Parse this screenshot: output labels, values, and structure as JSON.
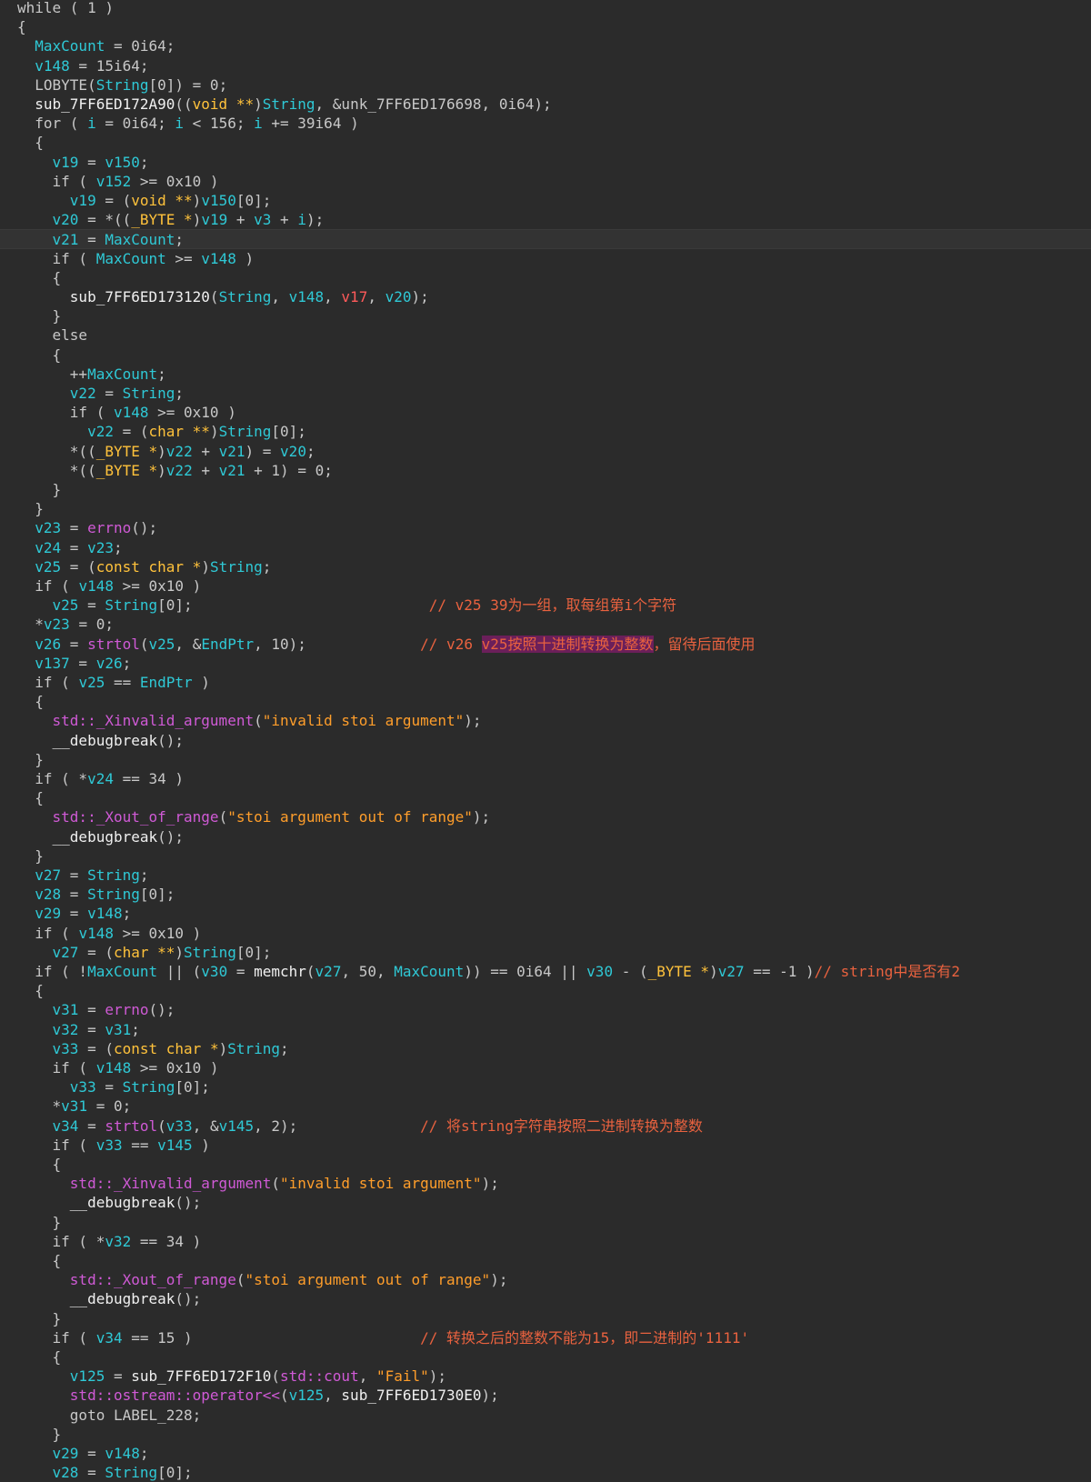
{
  "colors": {
    "background": "#2b2b2b",
    "plain": "#c8c8c8",
    "variable": "#2fc9d6",
    "function": "#f0f0f0",
    "keyword_type": "#ffc23b",
    "library": "#d05ad6",
    "string": "#ff9e2b",
    "comment": "#e9623f",
    "red_var": "#ff5a5a",
    "highlight": "#6b1f5a"
  },
  "current_line_index": 12,
  "lines": [
    [
      [
        "o",
        "while ( 1 )"
      ]
    ],
    [
      [
        "o",
        "{"
      ]
    ],
    [
      [
        "o",
        "  "
      ],
      [
        "v",
        "MaxCount"
      ],
      [
        "o",
        " = 0i64;"
      ]
    ],
    [
      [
        "o",
        "  "
      ],
      [
        "v",
        "v148"
      ],
      [
        "o",
        " = 15i64;"
      ]
    ],
    [
      [
        "o",
        "  LOBYTE("
      ],
      [
        "v",
        "String"
      ],
      [
        "o",
        "[0]) = 0;"
      ]
    ],
    [
      [
        "o",
        "  "
      ],
      [
        "f",
        "sub_7FF6ED172A90"
      ],
      [
        "o",
        "(("
      ],
      [
        "k",
        "void"
      ],
      [
        "o",
        " "
      ],
      [
        "k",
        "**"
      ],
      [
        "o",
        ")"
      ],
      [
        "v",
        "String"
      ],
      [
        "o",
        ", &unk_7FF6ED176698, 0i64);"
      ]
    ],
    [
      [
        "o",
        "  for ( "
      ],
      [
        "v",
        "i"
      ],
      [
        "o",
        " = 0i64; "
      ],
      [
        "v",
        "i"
      ],
      [
        "o",
        " < 156; "
      ],
      [
        "v",
        "i"
      ],
      [
        "o",
        " += 39i64 )"
      ]
    ],
    [
      [
        "o",
        "  {"
      ]
    ],
    [
      [
        "o",
        "    "
      ],
      [
        "v",
        "v19"
      ],
      [
        "o",
        " = "
      ],
      [
        "v",
        "v150"
      ],
      [
        "o",
        ";"
      ]
    ],
    [
      [
        "o",
        "    if ( "
      ],
      [
        "v",
        "v152"
      ],
      [
        "o",
        " >= 0x10 )"
      ]
    ],
    [
      [
        "o",
        "      "
      ],
      [
        "v",
        "v19"
      ],
      [
        "o",
        " = ("
      ],
      [
        "k",
        "void"
      ],
      [
        "o",
        " "
      ],
      [
        "k",
        "**"
      ],
      [
        "o",
        ")"
      ],
      [
        "v",
        "v150"
      ],
      [
        "o",
        "[0];"
      ]
    ],
    [
      [
        "o",
        "    "
      ],
      [
        "v",
        "v20"
      ],
      [
        "o",
        " = *(("
      ],
      [
        "k",
        "_BYTE"
      ],
      [
        "o",
        " "
      ],
      [
        "k",
        "*"
      ],
      [
        "o",
        ")"
      ],
      [
        "v",
        "v19"
      ],
      [
        "o",
        " + "
      ],
      [
        "v",
        "v3"
      ],
      [
        "o",
        " + "
      ],
      [
        "v",
        "i"
      ],
      [
        "o",
        ");"
      ]
    ],
    [
      [
        "o",
        "    "
      ],
      [
        "v",
        "v21"
      ],
      [
        "o",
        " = "
      ],
      [
        "v",
        "MaxCount"
      ],
      [
        "o",
        ";"
      ]
    ],
    [
      [
        "o",
        "    if ( "
      ],
      [
        "v",
        "MaxCount"
      ],
      [
        "o",
        " >= "
      ],
      [
        "v",
        "v148"
      ],
      [
        "o",
        " )"
      ]
    ],
    [
      [
        "o",
        "    {"
      ]
    ],
    [
      [
        "o",
        "      "
      ],
      [
        "f",
        "sub_7FF6ED173120"
      ],
      [
        "o",
        "("
      ],
      [
        "v",
        "String"
      ],
      [
        "o",
        ", "
      ],
      [
        "v",
        "v148"
      ],
      [
        "o",
        ", "
      ],
      [
        "r",
        "v17"
      ],
      [
        "o",
        ", "
      ],
      [
        "v",
        "v20"
      ],
      [
        "o",
        ");"
      ]
    ],
    [
      [
        "o",
        "    }"
      ]
    ],
    [
      [
        "o",
        "    else"
      ]
    ],
    [
      [
        "o",
        "    {"
      ]
    ],
    [
      [
        "o",
        "      ++"
      ],
      [
        "v",
        "MaxCount"
      ],
      [
        "o",
        ";"
      ]
    ],
    [
      [
        "o",
        "      "
      ],
      [
        "v",
        "v22"
      ],
      [
        "o",
        " = "
      ],
      [
        "v",
        "String"
      ],
      [
        "o",
        ";"
      ]
    ],
    [
      [
        "o",
        "      if ( "
      ],
      [
        "v",
        "v148"
      ],
      [
        "o",
        " >= 0x10 )"
      ]
    ],
    [
      [
        "o",
        "        "
      ],
      [
        "v",
        "v22"
      ],
      [
        "o",
        " = ("
      ],
      [
        "k",
        "char"
      ],
      [
        "o",
        " "
      ],
      [
        "k",
        "**"
      ],
      [
        "o",
        ")"
      ],
      [
        "v",
        "String"
      ],
      [
        "o",
        "[0];"
      ]
    ],
    [
      [
        "o",
        "      *(("
      ],
      [
        "k",
        "_BYTE"
      ],
      [
        "o",
        " "
      ],
      [
        "k",
        "*"
      ],
      [
        "o",
        ")"
      ],
      [
        "v",
        "v22"
      ],
      [
        "o",
        " + "
      ],
      [
        "v",
        "v21"
      ],
      [
        "o",
        ") = "
      ],
      [
        "v",
        "v20"
      ],
      [
        "o",
        ";"
      ]
    ],
    [
      [
        "o",
        "      *(("
      ],
      [
        "k",
        "_BYTE"
      ],
      [
        "o",
        " "
      ],
      [
        "k",
        "*"
      ],
      [
        "o",
        ")"
      ],
      [
        "v",
        "v22"
      ],
      [
        "o",
        " + "
      ],
      [
        "v",
        "v21"
      ],
      [
        "o",
        " + 1) = 0;"
      ]
    ],
    [
      [
        "o",
        "    }"
      ]
    ],
    [
      [
        "o",
        "  }"
      ]
    ],
    [
      [
        "o",
        "  "
      ],
      [
        "v",
        "v23"
      ],
      [
        "o",
        " = "
      ],
      [
        "p",
        "errno"
      ],
      [
        "o",
        "();"
      ]
    ],
    [
      [
        "o",
        "  "
      ],
      [
        "v",
        "v24"
      ],
      [
        "o",
        " = "
      ],
      [
        "v",
        "v23"
      ],
      [
        "o",
        ";"
      ]
    ],
    [
      [
        "o",
        "  "
      ],
      [
        "v",
        "v25"
      ],
      [
        "o",
        " = ("
      ],
      [
        "k",
        "const char"
      ],
      [
        "o",
        " "
      ],
      [
        "k",
        "*"
      ],
      [
        "o",
        ")"
      ],
      [
        "v",
        "String"
      ],
      [
        "o",
        ";"
      ]
    ],
    [
      [
        "o",
        "  if ( "
      ],
      [
        "v",
        "v148"
      ],
      [
        "o",
        " >= 0x10 )"
      ]
    ],
    [
      [
        "o",
        "    "
      ],
      [
        "v",
        "v25"
      ],
      [
        "o",
        " = "
      ],
      [
        "v",
        "String"
      ],
      [
        "o",
        "[0];                           "
      ],
      [
        "c",
        "// v25 39为一组，取每组第i个字符"
      ]
    ],
    [
      [
        "o",
        "  *"
      ],
      [
        "v",
        "v23"
      ],
      [
        "o",
        " = 0;"
      ]
    ],
    [
      [
        "o",
        "  "
      ],
      [
        "v",
        "v26"
      ],
      [
        "o",
        " = "
      ],
      [
        "p",
        "strtol"
      ],
      [
        "o",
        "("
      ],
      [
        "v",
        "v25"
      ],
      [
        "o",
        ", &"
      ],
      [
        "v",
        "EndPtr"
      ],
      [
        "o",
        ", 10);             "
      ],
      [
        "c",
        "// v26 "
      ],
      [
        "h",
        "v25按照十进制转换为整数"
      ],
      [
        "c",
        "，留待后面使用"
      ]
    ],
    [
      [
        "o",
        "  "
      ],
      [
        "v",
        "v137"
      ],
      [
        "o",
        " = "
      ],
      [
        "v",
        "v26"
      ],
      [
        "o",
        ";"
      ]
    ],
    [
      [
        "o",
        "  if ( "
      ],
      [
        "v",
        "v25"
      ],
      [
        "o",
        " == "
      ],
      [
        "v",
        "EndPtr"
      ],
      [
        "o",
        " )"
      ]
    ],
    [
      [
        "o",
        "  {"
      ]
    ],
    [
      [
        "o",
        "    "
      ],
      [
        "p",
        "std::_Xinvalid_argument"
      ],
      [
        "o",
        "("
      ],
      [
        "s",
        "\"invalid stoi argument\""
      ],
      [
        "o",
        ");"
      ]
    ],
    [
      [
        "o",
        "    "
      ],
      [
        "f",
        "__debugbreak"
      ],
      [
        "o",
        "();"
      ]
    ],
    [
      [
        "o",
        "  }"
      ]
    ],
    [
      [
        "o",
        "  if ( *"
      ],
      [
        "v",
        "v24"
      ],
      [
        "o",
        " == 34 )"
      ]
    ],
    [
      [
        "o",
        "  {"
      ]
    ],
    [
      [
        "o",
        "    "
      ],
      [
        "p",
        "std::_Xout_of_range"
      ],
      [
        "o",
        "("
      ],
      [
        "s",
        "\"stoi argument out of range\""
      ],
      [
        "o",
        ");"
      ]
    ],
    [
      [
        "o",
        "    "
      ],
      [
        "f",
        "__debugbreak"
      ],
      [
        "o",
        "();"
      ]
    ],
    [
      [
        "o",
        "  }"
      ]
    ],
    [
      [
        "o",
        "  "
      ],
      [
        "v",
        "v27"
      ],
      [
        "o",
        " = "
      ],
      [
        "v",
        "String"
      ],
      [
        "o",
        ";"
      ]
    ],
    [
      [
        "o",
        "  "
      ],
      [
        "v",
        "v28"
      ],
      [
        "o",
        " = "
      ],
      [
        "v",
        "String"
      ],
      [
        "o",
        "[0];"
      ]
    ],
    [
      [
        "o",
        "  "
      ],
      [
        "v",
        "v29"
      ],
      [
        "o",
        " = "
      ],
      [
        "v",
        "v148"
      ],
      [
        "o",
        ";"
      ]
    ],
    [
      [
        "o",
        "  if ( "
      ],
      [
        "v",
        "v148"
      ],
      [
        "o",
        " >= 0x10 )"
      ]
    ],
    [
      [
        "o",
        "    "
      ],
      [
        "v",
        "v27"
      ],
      [
        "o",
        " = ("
      ],
      [
        "k",
        "char"
      ],
      [
        "o",
        " "
      ],
      [
        "k",
        "**"
      ],
      [
        "o",
        ")"
      ],
      [
        "v",
        "String"
      ],
      [
        "o",
        "[0];"
      ]
    ],
    [
      [
        "o",
        "  if ( !"
      ],
      [
        "v",
        "MaxCount"
      ],
      [
        "o",
        " || ("
      ],
      [
        "v",
        "v30"
      ],
      [
        "o",
        " = "
      ],
      [
        "f",
        "memchr"
      ],
      [
        "o",
        "("
      ],
      [
        "v",
        "v27"
      ],
      [
        "o",
        ", 50, "
      ],
      [
        "v",
        "MaxCount"
      ],
      [
        "o",
        ")) == 0i64 || "
      ],
      [
        "v",
        "v30"
      ],
      [
        "o",
        " - ("
      ],
      [
        "k",
        "_BYTE"
      ],
      [
        "o",
        " "
      ],
      [
        "k",
        "*"
      ],
      [
        "o",
        ")"
      ],
      [
        "v",
        "v27"
      ],
      [
        "o",
        " == -1 )"
      ],
      [
        "c",
        "// string中是否有2"
      ]
    ],
    [
      [
        "o",
        "  {"
      ]
    ],
    [
      [
        "o",
        "    "
      ],
      [
        "v",
        "v31"
      ],
      [
        "o",
        " = "
      ],
      [
        "p",
        "errno"
      ],
      [
        "o",
        "();"
      ]
    ],
    [
      [
        "o",
        "    "
      ],
      [
        "v",
        "v32"
      ],
      [
        "o",
        " = "
      ],
      [
        "v",
        "v31"
      ],
      [
        "o",
        ";"
      ]
    ],
    [
      [
        "o",
        "    "
      ],
      [
        "v",
        "v33"
      ],
      [
        "o",
        " = ("
      ],
      [
        "k",
        "const char"
      ],
      [
        "o",
        " "
      ],
      [
        "k",
        "*"
      ],
      [
        "o",
        ")"
      ],
      [
        "v",
        "String"
      ],
      [
        "o",
        ";"
      ]
    ],
    [
      [
        "o",
        "    if ( "
      ],
      [
        "v",
        "v148"
      ],
      [
        "o",
        " >= 0x10 )"
      ]
    ],
    [
      [
        "o",
        "      "
      ],
      [
        "v",
        "v33"
      ],
      [
        "o",
        " = "
      ],
      [
        "v",
        "String"
      ],
      [
        "o",
        "[0];"
      ]
    ],
    [
      [
        "o",
        "    *"
      ],
      [
        "v",
        "v31"
      ],
      [
        "o",
        " = 0;"
      ]
    ],
    [
      [
        "o",
        "    "
      ],
      [
        "v",
        "v34"
      ],
      [
        "o",
        " = "
      ],
      [
        "p",
        "strtol"
      ],
      [
        "o",
        "("
      ],
      [
        "v",
        "v33"
      ],
      [
        "o",
        ", &"
      ],
      [
        "v",
        "v145"
      ],
      [
        "o",
        ", 2);              "
      ],
      [
        "c",
        "// 将string字符串按照二进制转换为整数"
      ]
    ],
    [
      [
        "o",
        "    if ( "
      ],
      [
        "v",
        "v33"
      ],
      [
        "o",
        " == "
      ],
      [
        "v",
        "v145"
      ],
      [
        "o",
        " )"
      ]
    ],
    [
      [
        "o",
        "    {"
      ]
    ],
    [
      [
        "o",
        "      "
      ],
      [
        "p",
        "std::_Xinvalid_argument"
      ],
      [
        "o",
        "("
      ],
      [
        "s",
        "\"invalid stoi argument\""
      ],
      [
        "o",
        ");"
      ]
    ],
    [
      [
        "o",
        "      "
      ],
      [
        "f",
        "__debugbreak"
      ],
      [
        "o",
        "();"
      ]
    ],
    [
      [
        "o",
        "    }"
      ]
    ],
    [
      [
        "o",
        "    if ( *"
      ],
      [
        "v",
        "v32"
      ],
      [
        "o",
        " == 34 )"
      ]
    ],
    [
      [
        "o",
        "    {"
      ]
    ],
    [
      [
        "o",
        "      "
      ],
      [
        "p",
        "std::_Xout_of_range"
      ],
      [
        "o",
        "("
      ],
      [
        "s",
        "\"stoi argument out of range\""
      ],
      [
        "o",
        ");"
      ]
    ],
    [
      [
        "o",
        "      "
      ],
      [
        "f",
        "__debugbreak"
      ],
      [
        "o",
        "();"
      ]
    ],
    [
      [
        "o",
        "    }"
      ]
    ],
    [
      [
        "o",
        "    if ( "
      ],
      [
        "v",
        "v34"
      ],
      [
        "o",
        " == 15 )                          "
      ],
      [
        "c",
        "// 转换之后的整数不能为15，即二进制的'1111'"
      ]
    ],
    [
      [
        "o",
        "    {"
      ]
    ],
    [
      [
        "o",
        "      "
      ],
      [
        "v",
        "v125"
      ],
      [
        "o",
        " = "
      ],
      [
        "f",
        "sub_7FF6ED172F10"
      ],
      [
        "o",
        "("
      ],
      [
        "p",
        "std::cout"
      ],
      [
        "o",
        ", "
      ],
      [
        "s",
        "\"Fail\""
      ],
      [
        "o",
        ");"
      ]
    ],
    [
      [
        "o",
        "      "
      ],
      [
        "p",
        "std::ostream::operator<<"
      ],
      [
        "o",
        "("
      ],
      [
        "v",
        "v125"
      ],
      [
        "o",
        ", "
      ],
      [
        "f",
        "sub_7FF6ED1730E0"
      ],
      [
        "o",
        ");"
      ]
    ],
    [
      [
        "o",
        "      goto LABEL_228;"
      ]
    ],
    [
      [
        "o",
        "    }"
      ]
    ],
    [
      [
        "o",
        "    "
      ],
      [
        "v",
        "v29"
      ],
      [
        "o",
        " = "
      ],
      [
        "v",
        "v148"
      ],
      [
        "o",
        ";"
      ]
    ],
    [
      [
        "o",
        "    "
      ],
      [
        "v",
        "v28"
      ],
      [
        "o",
        " = "
      ],
      [
        "v",
        "String"
      ],
      [
        "o",
        "[0];"
      ]
    ]
  ]
}
